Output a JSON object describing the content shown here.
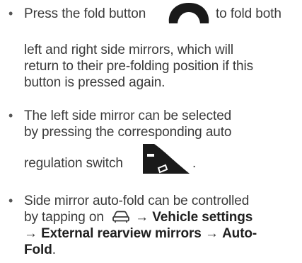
{
  "bullets": [
    {
      "line1_before": "Press the fold button",
      "line1_after": "to fold both",
      "line2": "left and right side mirrors, which will",
      "line3": "return to their pre-folding position if this",
      "line4": "button is pressed again.",
      "icon": "mirror-fold-button-icon"
    },
    {
      "line1": "The left side mirror can be selected",
      "line2": "by pressing the corresponding auto",
      "line3_before": "regulation switch",
      "line3_after": ".",
      "icon": "mirror-selector-switch-icon"
    },
    {
      "line1": "Side mirror auto-fold can be controlled",
      "line2_before": "by tapping on",
      "arrow": "→",
      "vehicle_settings": "Vehicle settings",
      "external_mirrors": "External rearview mirrors",
      "autofold_part1": "Auto-",
      "autofold_part2": "Fold",
      "end": ".",
      "icon": "car-icon"
    }
  ],
  "bullet_symbol": "•",
  "colors": {
    "text": "#3a3a3a",
    "bold": "#1f1f1f",
    "icon_dark": "#1a1a1a"
  }
}
